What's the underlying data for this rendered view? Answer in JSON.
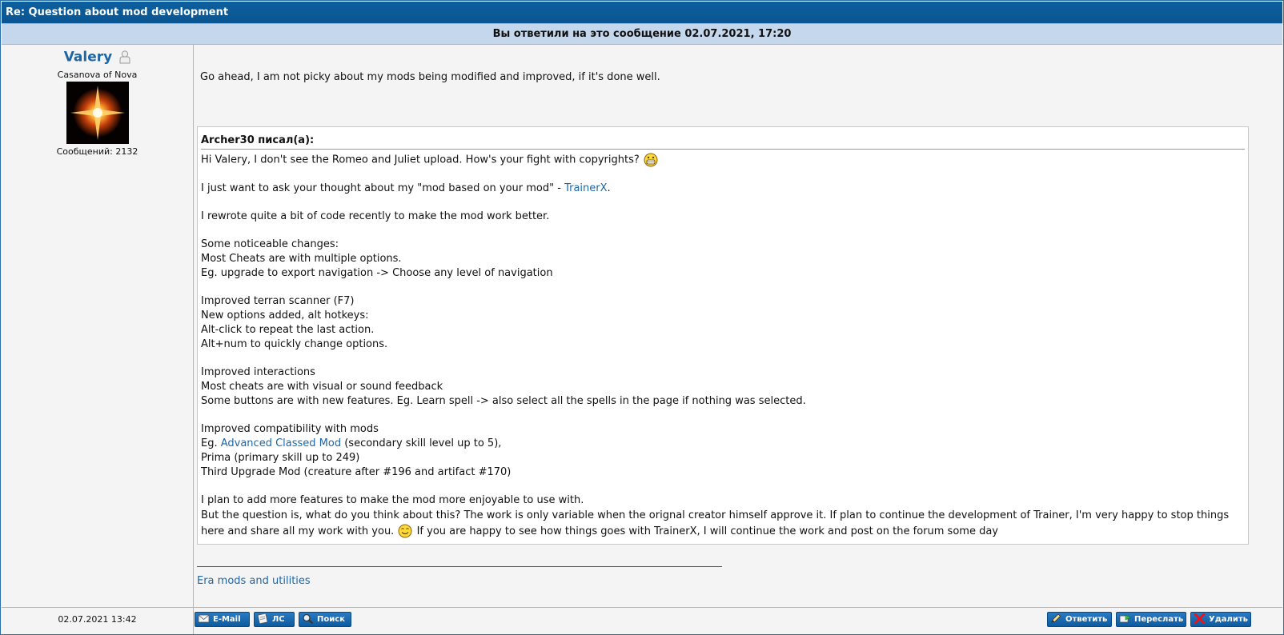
{
  "topic_title": "Re: Question about mod development",
  "reply_notice": "Вы ответили на это сообщение 02.07.2021, 17:20",
  "author": {
    "name": "Valery",
    "rank": "Casanova of Nova",
    "posts_label": "Сообщений: 2132",
    "status_icon": "offline-user-icon"
  },
  "post": {
    "reply_text": "Go ahead, I am not picky about my mods being modified and improved, if it's done well.",
    "date": "02.07.2021 13:42",
    "signature_link": "Era mods and utilities"
  },
  "quote": {
    "author_line": "Archer30 писал(а):",
    "lines": {
      "l1": "Hi Valery, I don't see the Romeo and Juliet upload. How's your fight with copyrights?",
      "l2a": "I just want to ask your thought about my \"mod based on your mod\" - ",
      "l2_link": "TrainerX",
      "l2b": ".",
      "l3": "I rewrote quite a bit of code recently to make the mod work better.",
      "l4": "Some noticeable changes:",
      "l5": "Most Cheats are with multiple options.",
      "l6": "Eg. upgrade to export navigation -> Choose any level of navigation",
      "l7": "Improved terran scanner (F7)",
      "l8": "New options added, alt hotkeys:",
      "l9": "Alt-click to repeat the last action.",
      "l10": "Alt+num to quickly change options.",
      "l11": "Improved interactions",
      "l12": "Most cheats are with visual or sound feedback",
      "l13": "Some buttons are with new features. Eg. Learn spell -> also select all the spells in the page if nothing was selected.",
      "l14": "Improved compatibility with mods",
      "l15a": "Eg. ",
      "l15_link": "Advanced Classed Mod",
      "l15b": " (secondary skill level up to 5),",
      "l16": "Prima (primary skill up to 249)",
      "l17": "Third Upgrade Mod (creature after #196 and artifact #170)",
      "l18": "I plan to add more features to make the mod more enjoyable to use with.",
      "l19": "But the question is, what do you think about this? The work is only variable when the orignal creator himself approve it. If plan to continue the development of Trainer, I'm very happy to stop things here and share all my work with you.",
      "l19b": " If you are happy to see how things goes with TrainerX, I will continue the work and post on the forum some day"
    }
  },
  "buttons": {
    "email": "E-Mail",
    "pm": "ЛС",
    "search": "Поиск",
    "reply": "Ответить",
    "forward": "Переслать",
    "delete": "Удалить"
  },
  "colors": {
    "title_bar": "#0a5592",
    "notice_bar": "#c5d7ec",
    "link": "#1c66a8",
    "button": "#0d5a9e"
  }
}
